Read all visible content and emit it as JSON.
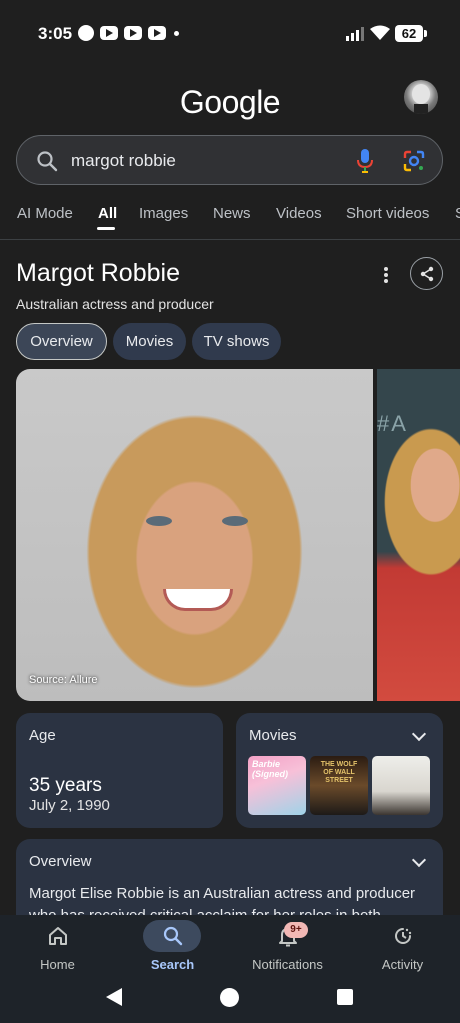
{
  "status_bar": {
    "time": "3:05",
    "battery": "62"
  },
  "header": {
    "logo": "Google"
  },
  "search": {
    "query": "margot robbie"
  },
  "tabs": [
    "AI Mode",
    "All",
    "Images",
    "News",
    "Videos",
    "Short videos",
    "S"
  ],
  "active_tab": "All",
  "knowledge_panel": {
    "title": "Margot Robbie",
    "subtitle": "Australian actress and producer",
    "chips": [
      "Overview",
      "Movies",
      "TV shows"
    ],
    "image_source": "Source: Allure",
    "side_image_text": "#A"
  },
  "age_card": {
    "label": "Age",
    "value": "35 years",
    "date": "July 2, 1990"
  },
  "movies_card": {
    "label": "Movies",
    "posters": [
      {
        "title": "Barbie",
        "extra": "(Signed)"
      },
      {
        "title": "THE WOLF OF WALL STREET"
      },
      {
        "title": ""
      }
    ]
  },
  "overview_card": {
    "label": "Overview",
    "text": "Margot Elise Robbie is an Australian actress and producer who has received critical acclaim for her roles in both"
  },
  "bottom_nav": {
    "items": [
      {
        "label": "Home",
        "icon": "home-icon"
      },
      {
        "label": "Search",
        "icon": "search-icon"
      },
      {
        "label": "Notifications",
        "icon": "bell-icon"
      },
      {
        "label": "Activity",
        "icon": "activity-icon"
      }
    ],
    "badge": "9+"
  },
  "colors": {
    "accent": "#a8c7fa",
    "card": "#2b3342",
    "background": "#1f1f1f"
  }
}
